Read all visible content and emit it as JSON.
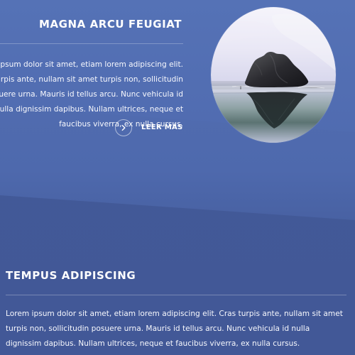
{
  "feature": {
    "title": "MAGNA ARCU FEUGIAT",
    "text": "Lorem ipsum dolor sit amet, etiam lorem adipiscing elit. Cras turpis ante, nullam sit amet turpis non, sollicitudin posuere urna. Mauris id tellus arcu. Nunc vehicula id nulla dignissim dapibus. Nullam ultrices, neque et faucibus viverra, ex nulla cursus.",
    "read_more": "LEER MÁS",
    "read_more_icon": "chevron-right-icon"
  },
  "section_two": {
    "title": "TEMPUS ADIPISCING",
    "text": "Lorem ipsum dolor sit amet, etiam lorem adipiscing elit. Cras turpis ante, nullam sit amet turpis non, sollicitudin posuere urna. Mauris id tellus arcu. Nunc vehicula id nulla dignissim dapibus. Nullam ultrices, neque et faucibus viverra, ex nulla cursus."
  },
  "colors": {
    "background": "#4d68ad",
    "background_lower": "#435a98",
    "text": "#ffffff"
  }
}
